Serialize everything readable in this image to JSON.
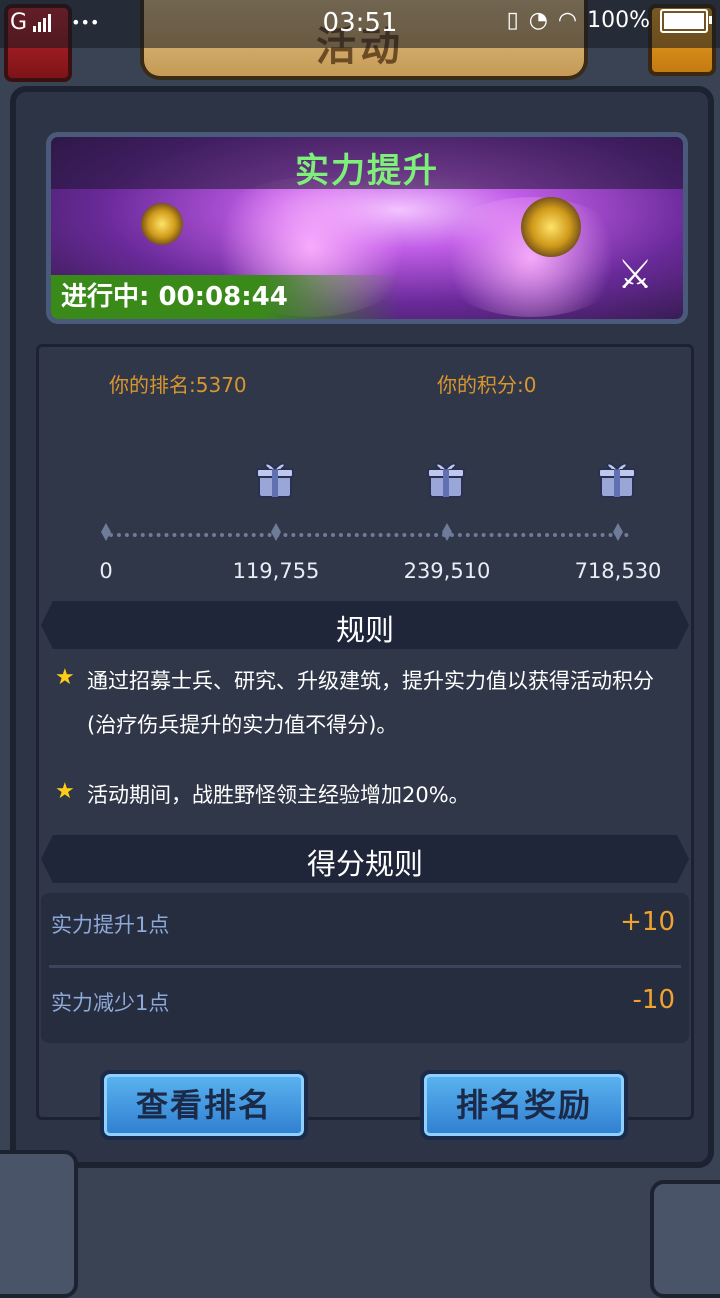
{
  "status_bar": {
    "carrier": "G",
    "dots": "•••",
    "time": "03:51",
    "battery": "100%"
  },
  "header": {
    "title": "活动"
  },
  "event": {
    "title": "实力提升",
    "status_label": "进行中:",
    "countdown": "00:08:44"
  },
  "stats": {
    "rank_label": "你的排名:",
    "rank_value": "5370",
    "score_label": "你的积分:",
    "score_value": "0"
  },
  "progress": {
    "milestones": [
      "0",
      "119,755",
      "239,510",
      "718,530"
    ]
  },
  "rules": {
    "title": "规则",
    "items": [
      "通过招募士兵、研究、升级建筑，提升实力值以获得活动积分(治疗伤兵提升的实力值不得分)。",
      "活动期间，战胜野怪领主经验增加20%。"
    ]
  },
  "scoring": {
    "title": "得分规则",
    "rows": [
      {
        "label": "实力提升1点",
        "value": "+10"
      },
      {
        "label": "实力减少1点",
        "value": "-10"
      }
    ]
  },
  "buttons": {
    "view_rank": "查看排名",
    "rank_reward": "排名奖励"
  },
  "colors": {
    "accent_gold": "#d9962e",
    "event_green": "#7ef07a",
    "button_blue": "#2f7ed0"
  }
}
